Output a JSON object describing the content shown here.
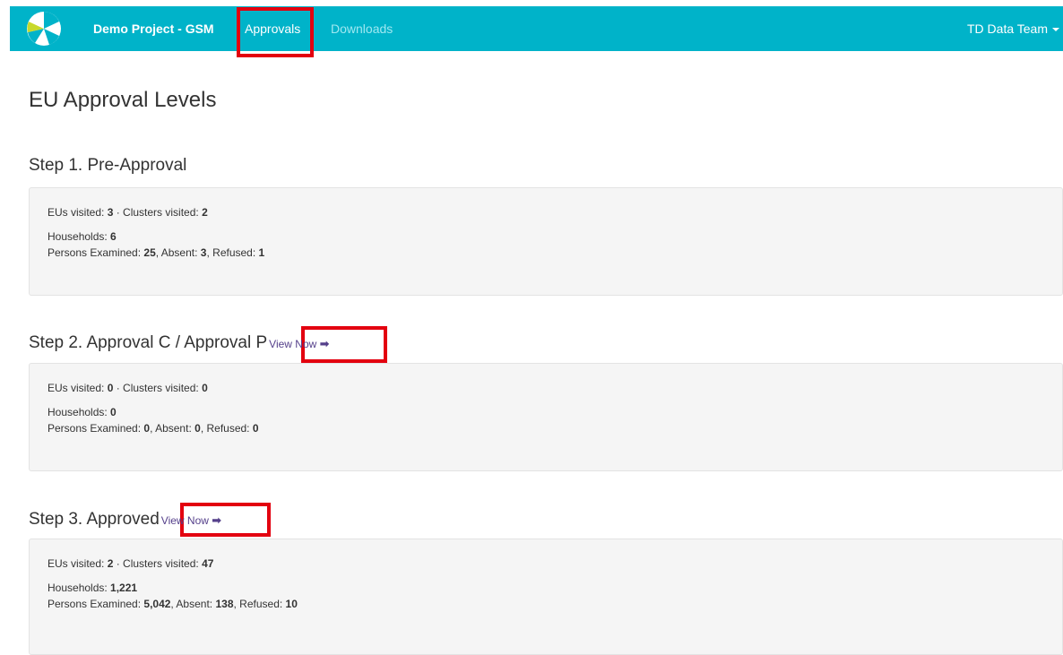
{
  "navbar": {
    "brand": "Demo Project - GSM",
    "links": [
      {
        "label": "Approvals"
      },
      {
        "label": "Downloads"
      }
    ],
    "user": "TD Data Team",
    "colors": {
      "background": "#00b3c9",
      "active_link": "#ffffff",
      "inactive_link": "#9fe8f1"
    }
  },
  "page": {
    "title": "EU Approval Levels",
    "view_now_label": "View Now",
    "view_now_icon": "right-arrow-icon"
  },
  "labels": {
    "eus_visited": "EUs visited: ",
    "separator": " · ",
    "clusters_visited": "Clusters visited: ",
    "households": "Households: ",
    "persons_examined": "Persons Examined: ",
    "absent": ", Absent: ",
    "refused": ", Refused: "
  },
  "steps": [
    {
      "title": "Step 1. Pre-Approval",
      "eus_visited": "3",
      "clusters_visited": "2",
      "households": "6",
      "persons_examined": "25",
      "absent": "3",
      "refused": "1"
    },
    {
      "title": "Step 2. Approval C / Approval P",
      "eus_visited": "0",
      "clusters_visited": "0",
      "households": "0",
      "persons_examined": "0",
      "absent": "0",
      "refused": "0"
    },
    {
      "title": "Step 3. Approved",
      "eus_visited": "2",
      "clusters_visited": "47",
      "households": "1,221",
      "persons_examined": "5,042",
      "absent": "138",
      "refused": "10"
    }
  ],
  "annotation_color": "#e3000f"
}
